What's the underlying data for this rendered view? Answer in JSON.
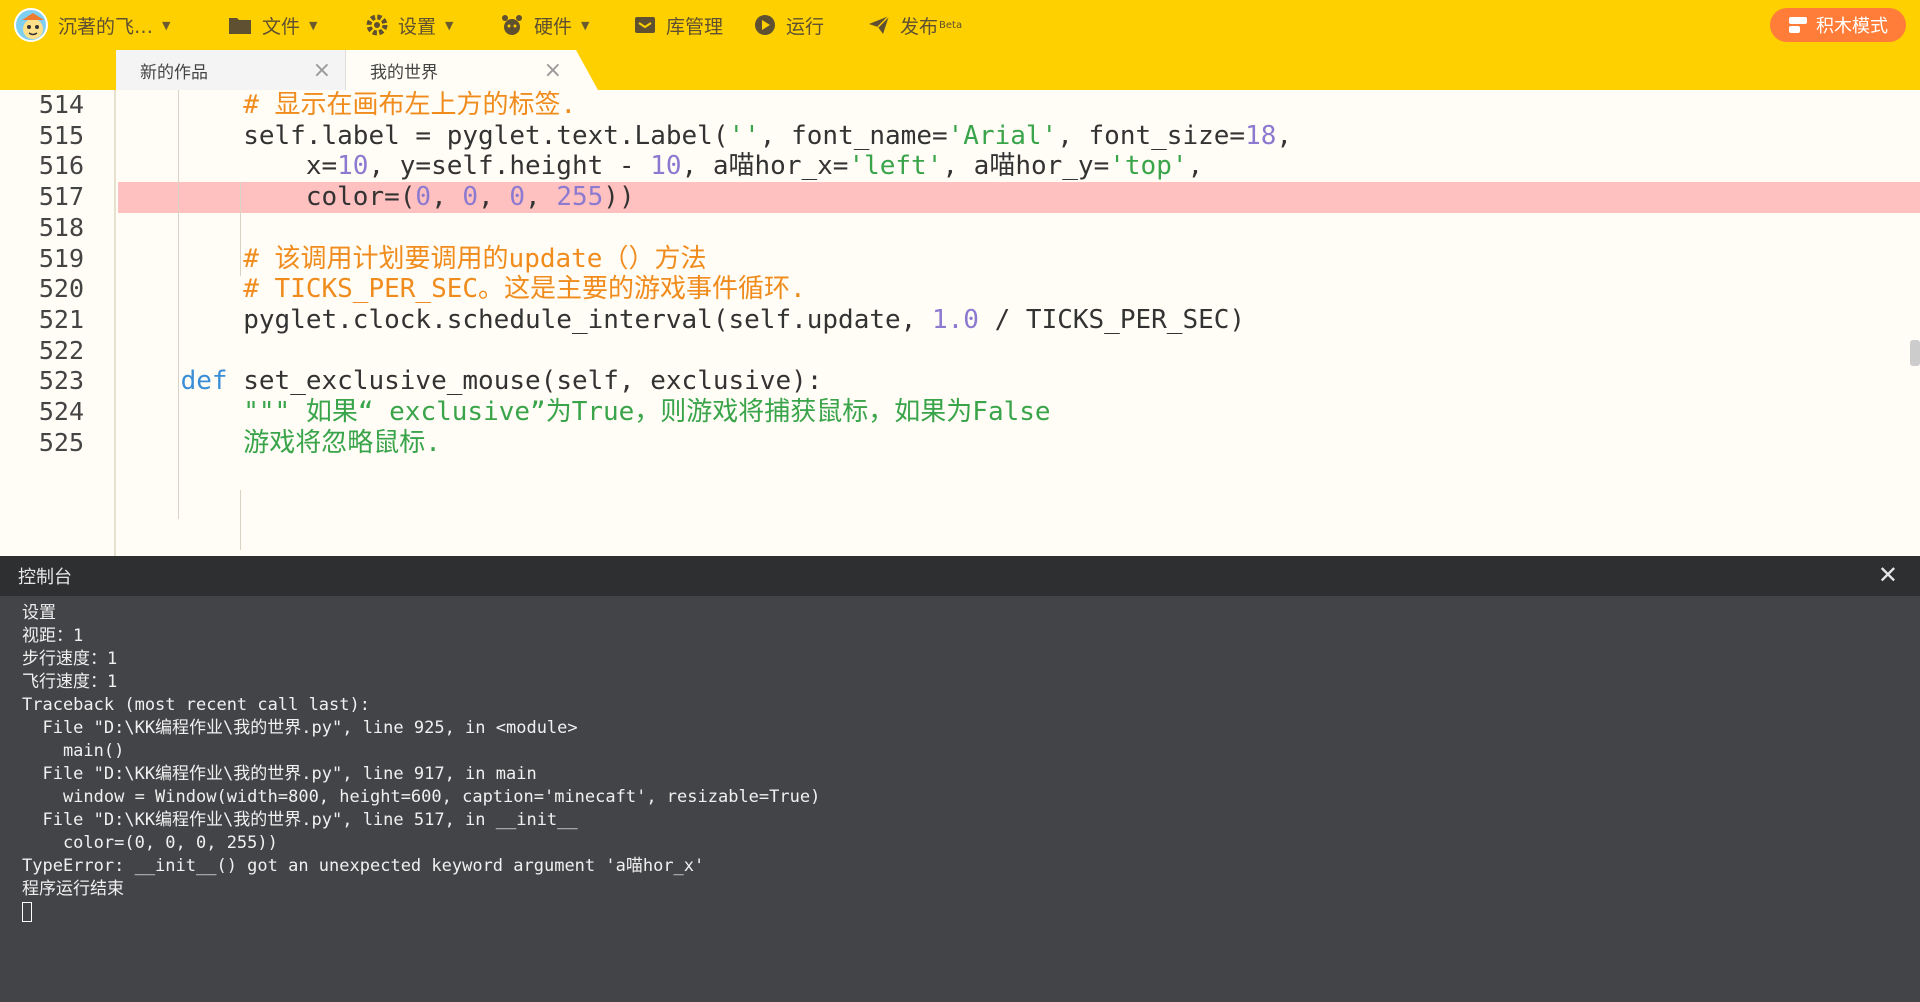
{
  "topbar": {
    "user_name": "沉著的飞…",
    "menu": [
      "文件",
      "设置",
      "硬件",
      "库管理",
      "运行"
    ],
    "publish_label": "发布",
    "publish_badge": "Beta",
    "mode_button": "积木模式"
  },
  "tabs": [
    {
      "label": "新的作品"
    },
    {
      "label": "我的世界"
    }
  ],
  "editor": {
    "lines": [
      {
        "no": "514",
        "highlight": false,
        "tokens": [
          {
            "t": "        "
          },
          {
            "t": "# 显示在画布左上方的标签.",
            "c": "cm"
          }
        ]
      },
      {
        "no": "515",
        "highlight": false,
        "tokens": [
          {
            "t": "        self.label = pyglet.text.Label("
          },
          {
            "t": "''",
            "c": "st"
          },
          {
            "t": ", font_name="
          },
          {
            "t": "'Arial'",
            "c": "st"
          },
          {
            "t": ", font_size="
          },
          {
            "t": "18",
            "c": "nm"
          },
          {
            "t": ","
          }
        ]
      },
      {
        "no": "516",
        "highlight": false,
        "tokens": [
          {
            "t": "            x="
          },
          {
            "t": "10",
            "c": "nm"
          },
          {
            "t": ", y=self.height - "
          },
          {
            "t": "10",
            "c": "nm"
          },
          {
            "t": ", a喵hor_x="
          },
          {
            "t": "'left'",
            "c": "st"
          },
          {
            "t": ", a喵hor_y="
          },
          {
            "t": "'top'",
            "c": "st"
          },
          {
            "t": ","
          }
        ]
      },
      {
        "no": "517",
        "highlight": true,
        "tokens": [
          {
            "t": "            color=("
          },
          {
            "t": "0",
            "c": "nm"
          },
          {
            "t": ", "
          },
          {
            "t": "0",
            "c": "nm"
          },
          {
            "t": ", "
          },
          {
            "t": "0",
            "c": "nm"
          },
          {
            "t": ", "
          },
          {
            "t": "255",
            "c": "nm"
          },
          {
            "t": "))"
          }
        ]
      },
      {
        "no": "518",
        "highlight": false,
        "tokens": [
          {
            "t": ""
          }
        ]
      },
      {
        "no": "519",
        "highlight": false,
        "tokens": [
          {
            "t": "        "
          },
          {
            "t": "# 该调用计划要调用的update（）方法",
            "c": "cm"
          }
        ]
      },
      {
        "no": "520",
        "highlight": false,
        "tokens": [
          {
            "t": "        "
          },
          {
            "t": "# TICKS_PER_SEC。这是主要的游戏事件循环.",
            "c": "cm"
          }
        ]
      },
      {
        "no": "521",
        "highlight": false,
        "tokens": [
          {
            "t": "        pyglet.clock.schedule_interval(self.update, "
          },
          {
            "t": "1.0",
            "c": "nm"
          },
          {
            "t": " / TICKS_PER_SEC)"
          }
        ]
      },
      {
        "no": "522",
        "highlight": false,
        "tokens": [
          {
            "t": ""
          }
        ]
      },
      {
        "no": "523",
        "highlight": false,
        "tokens": [
          {
            "t": "    "
          },
          {
            "t": "def",
            "c": "kw"
          },
          {
            "t": " set_exclusive_mouse(self, exclusive):"
          }
        ]
      },
      {
        "no": "524",
        "highlight": false,
        "tokens": [
          {
            "t": "        "
          },
          {
            "t": "\"\"\" 如果“ exclusive”为True，则游戏将捕获鼠标，如果为False",
            "c": "st"
          }
        ]
      },
      {
        "no": "525",
        "highlight": false,
        "tokens": [
          {
            "t": "        "
          },
          {
            "t": "游戏将忽略鼠标.",
            "c": "st"
          }
        ]
      }
    ],
    "run_button": "运行"
  },
  "console": {
    "title": "控制台",
    "lines": [
      "设置",
      "视距：1",
      "步行速度：1",
      "飞行速度：1",
      "Traceback (most recent call last):",
      "  File \"D:\\KK编程作业\\我的世界.py\", line 925, in <module>",
      "    main()",
      "  File \"D:\\KK编程作业\\我的世界.py\", line 917, in main",
      "    window = Window(width=800, height=600, caption='minecaft', resizable=True)",
      "  File \"D:\\KK编程作业\\我的世界.py\", line 517, in __init__",
      "    color=(0, 0, 0, 255))",
      "TypeError: __init__() got an unexpected keyword argument 'a喵hor_x'",
      "程序运行结束"
    ]
  },
  "colors": {
    "accent": "#ffd000",
    "mode_button": "#ff7d38",
    "error_line": "#ffc0c0",
    "comment": "#f08c1e",
    "string": "#3aa44a",
    "number": "#8c7ad0",
    "keyword": "#3a8ed8"
  },
  "icons": [
    "avatar",
    "folder-icon",
    "gear-icon",
    "hardware-icon",
    "library-icon",
    "play-icon",
    "send-icon",
    "blocks-icon",
    "close-icon"
  ]
}
